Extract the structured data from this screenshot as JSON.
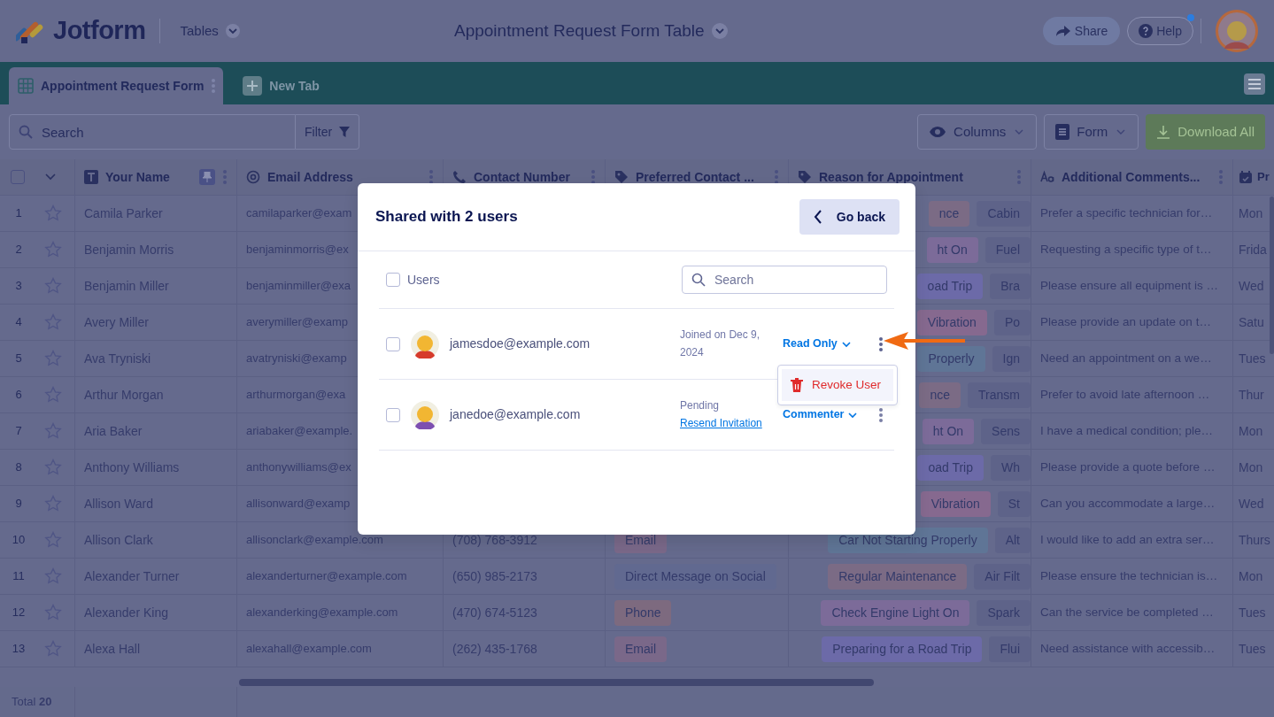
{
  "header": {
    "logo": "Jotform",
    "menu": "Tables",
    "title": "Appointment Request Form Table",
    "share": "Share",
    "help": "Help",
    "help_notification": true
  },
  "tabs": [
    {
      "label": "Appointment Request Form",
      "selected": true
    }
  ],
  "new_tab": "New Tab",
  "toolbar": {
    "search_placeholder": "Search",
    "filter": "Filter",
    "columns": "Columns",
    "form": "Form",
    "download": "Download All"
  },
  "table": {
    "columns": [
      {
        "label": "Your Name",
        "kind": "text",
        "pinned": true
      },
      {
        "label": "Email Address",
        "kind": "email",
        "pinned": false
      },
      {
        "label": "Contact Number",
        "kind": "phone",
        "pinned": false
      },
      {
        "label": "Preferred Contact ...",
        "kind": "tag",
        "pinned": false
      },
      {
        "label": "Reason for Appointment",
        "kind": "tag",
        "pinned": false
      },
      {
        "label": "Additional Comments...",
        "kind": "paragraph",
        "pinned": false
      },
      {
        "label": "Pr",
        "kind": "date",
        "pinned": false
      }
    ],
    "all_selected": false,
    "rows": [
      {
        "number": "1",
        "starred": false,
        "name": "Camila Parker",
        "email": "camilaparker@exam",
        "reason": [
          {
            "text": "nce",
            "color": "#7b6b85"
          },
          {
            "text": "Cabin",
            "color": "#5e6389"
          }
        ],
        "comment": "Prefer a specific technician for…",
        "column_8": "Mon"
      },
      {
        "number": "2",
        "starred": false,
        "name": "Benjamin Morris",
        "email": "benjaminmorris@ex",
        "reason": [
          {
            "text": "ht On",
            "color": "#7c6b99"
          },
          {
            "text": "Fuel",
            "color": "#5e6389"
          }
        ],
        "comment": "Requesting a specific type of t…",
        "column_8": "Frida"
      },
      {
        "number": "3",
        "starred": false,
        "name": "Benjamin Miller",
        "email": "benjaminmiller@exa",
        "reason": [
          {
            "text": "oad Trip",
            "color": "#6c6aa8"
          },
          {
            "text": "Bra",
            "color": "#5e6389"
          }
        ],
        "comment": "Please ensure all equipment is …",
        "column_8": "Wed"
      },
      {
        "number": "4",
        "starred": false,
        "name": "Avery Miller",
        "email": "averymiller@examp",
        "reason": [
          {
            "text": "Vibration",
            "color": "#86698f"
          },
          {
            "text": "Po",
            "color": "#5e6389"
          }
        ],
        "comment": "Please provide an update on t…",
        "column_8": "Satu"
      },
      {
        "number": "5",
        "starred": false,
        "name": "Ava Tryniski",
        "email": "avatryniski@examp",
        "reason": [
          {
            "text": "Properly",
            "color": "#5f7596"
          },
          {
            "text": "Ign",
            "color": "#5e6389"
          }
        ],
        "comment": "Need an appointment on a we…",
        "column_8": "Tues"
      },
      {
        "number": "6",
        "starred": false,
        "name": "Arthur Morgan",
        "email": "arthurmorgan@exa",
        "reason": [
          {
            "text": "nce",
            "color": "#7b6b85"
          },
          {
            "text": "Transm",
            "color": "#5e6389"
          }
        ],
        "comment": "Prefer to avoid late afternoon …",
        "column_8": "Thur"
      },
      {
        "number": "7",
        "starred": false,
        "name": "Aria Baker",
        "email": "ariabaker@example.",
        "reason": [
          {
            "text": "ht On",
            "color": "#7c6b99"
          },
          {
            "text": "Sens",
            "color": "#5e6389"
          }
        ],
        "comment": "I have a medical condition; ple…",
        "column_8": "Mon"
      },
      {
        "number": "8",
        "starred": false,
        "name": "Anthony Williams",
        "email": "anthonywilliams@ex",
        "reason": [
          {
            "text": "oad Trip",
            "color": "#6c6aa8"
          },
          {
            "text": "Wh",
            "color": "#5e6389"
          }
        ],
        "comment": "Please provide a quote before …",
        "column_8": "Mon"
      },
      {
        "number": "9",
        "starred": false,
        "name": "Allison Ward",
        "email": "allisonward@examp",
        "reason": [
          {
            "text": "Vibration",
            "color": "#86698f"
          },
          {
            "text": "St",
            "color": "#5e6389"
          }
        ],
        "comment": "Can you accommodate a large…",
        "column_8": "Wed"
      },
      {
        "number": "10",
        "starred": false,
        "name": "Allison Clark",
        "email": "allisonclark@example.com",
        "contact": "(708) 768-3912",
        "preferred": [
          {
            "text": "Email",
            "color": "#7a6889"
          }
        ],
        "reason": [
          {
            "text": "Car Not Starting Properly",
            "color": "#5f7596"
          },
          {
            "text": "Alt",
            "color": "#5e6389"
          }
        ],
        "comment": "I would like to add an extra ser…",
        "column_8": "Thurs"
      },
      {
        "number": "11",
        "starred": false,
        "name": "Alexander Turner",
        "email": "alexanderturner@example.com",
        "contact": "(650) 985-2173",
        "preferred": [
          {
            "text": "Direct Message on Social",
            "color": "#616990"
          }
        ],
        "reason": [
          {
            "text": "Regular Maintenance",
            "color": "#7b6b85"
          },
          {
            "text": "Air Filt",
            "color": "#5e6389"
          }
        ],
        "comment": "Please ensure the technician is…",
        "column_8": "Mon"
      },
      {
        "number": "12",
        "starred": false,
        "name": "Alexander King",
        "email": "alexanderking@example.com",
        "contact": "(470) 674-5123",
        "preferred": [
          {
            "text": "Phone",
            "color": "#7d6a7f"
          }
        ],
        "reason": [
          {
            "text": "Check Engine Light On",
            "color": "#7c6b99"
          },
          {
            "text": "Spark",
            "color": "#5e6389"
          }
        ],
        "comment": "Can the service be completed …",
        "column_8": "Tues"
      },
      {
        "number": "13",
        "starred": false,
        "name": "Alexa Hall",
        "email": "alexahall@example.com",
        "contact": "(262) 435-1768",
        "preferred": [
          {
            "text": "Email",
            "color": "#7a6889"
          }
        ],
        "reason": [
          {
            "text": "Preparing for a Road Trip",
            "color": "#6c6aa8"
          },
          {
            "text": "Flui",
            "color": "#5e6389"
          }
        ],
        "comment": "Need assistance with accessib…",
        "column_8": "Tues"
      }
    ],
    "footer": "Total **20**"
  },
  "modal": {
    "title": "Shared with 2 users",
    "back": "Go back",
    "users_label": "Users",
    "all_checked": false,
    "search_placeholder": "Search",
    "users": [
      {
        "email": "jamesdoe@example.com",
        "checked": false,
        "color": "#d63b2b",
        "status": "Joined on Dec 9, 2024",
        "role": "Read Only",
        "menu_open": true
      },
      {
        "email": "janedoe@example.com",
        "checked": false,
        "color": "#7d4fb0",
        "status": "Pending",
        "link": "Resend Invitation",
        "role": "Commenter",
        "menu_open": false
      }
    ],
    "menu_item": "Revoke User"
  }
}
